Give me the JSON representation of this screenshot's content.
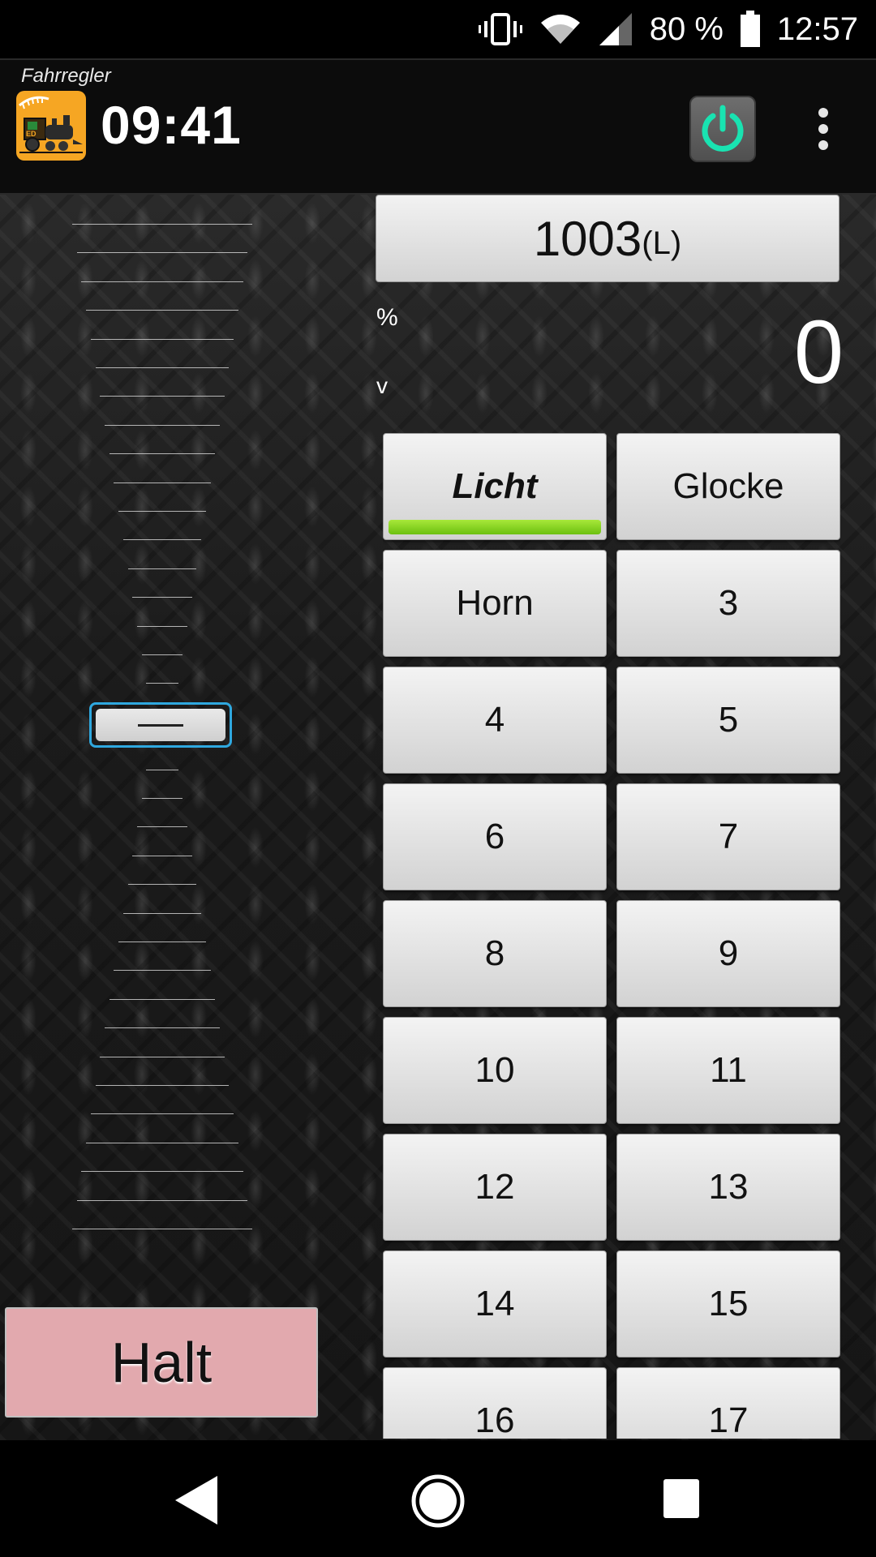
{
  "status_bar": {
    "battery_percent": "80 %",
    "time": "12:57",
    "icons": [
      "vibrate-icon",
      "wifi-icon",
      "cell-signal-icon",
      "battery-icon"
    ]
  },
  "app_bar": {
    "subtitle": "Fahrregler",
    "clock": "09:41",
    "logo_icon": "locomotive-logo-icon",
    "power_icon": "power-icon",
    "menu_icon": "overflow-menu-icon",
    "power_color": "#19e3b1"
  },
  "throttle": {
    "speed_percent_label": "%",
    "speed_unit_label": "v",
    "speed_value": "0"
  },
  "loco": {
    "address": "1003",
    "address_type": "(L)"
  },
  "functions": [
    {
      "label": "Licht",
      "active": true
    },
    {
      "label": "Glocke",
      "active": false
    },
    {
      "label": "Horn",
      "active": false
    },
    {
      "label": "3",
      "active": false
    },
    {
      "label": "4",
      "active": false
    },
    {
      "label": "5",
      "active": false
    },
    {
      "label": "6",
      "active": false
    },
    {
      "label": "7",
      "active": false
    },
    {
      "label": "8",
      "active": false
    },
    {
      "label": "9",
      "active": false
    },
    {
      "label": "10",
      "active": false
    },
    {
      "label": "11",
      "active": false
    },
    {
      "label": "12",
      "active": false
    },
    {
      "label": "13",
      "active": false
    },
    {
      "label": "14",
      "active": false
    },
    {
      "label": "15",
      "active": false
    },
    {
      "label": "16",
      "active": false
    },
    {
      "label": "17",
      "active": false
    }
  ],
  "halt_button": "Halt",
  "colors": {
    "halt_background": "#e2a9ae",
    "function_active_indicator": "#8fd624",
    "throttle_knob_border": "#2fa8df",
    "app_logo_background": "#f6a623"
  },
  "nav_bar": {
    "icons": [
      "back-icon",
      "home-icon",
      "recents-icon"
    ]
  }
}
